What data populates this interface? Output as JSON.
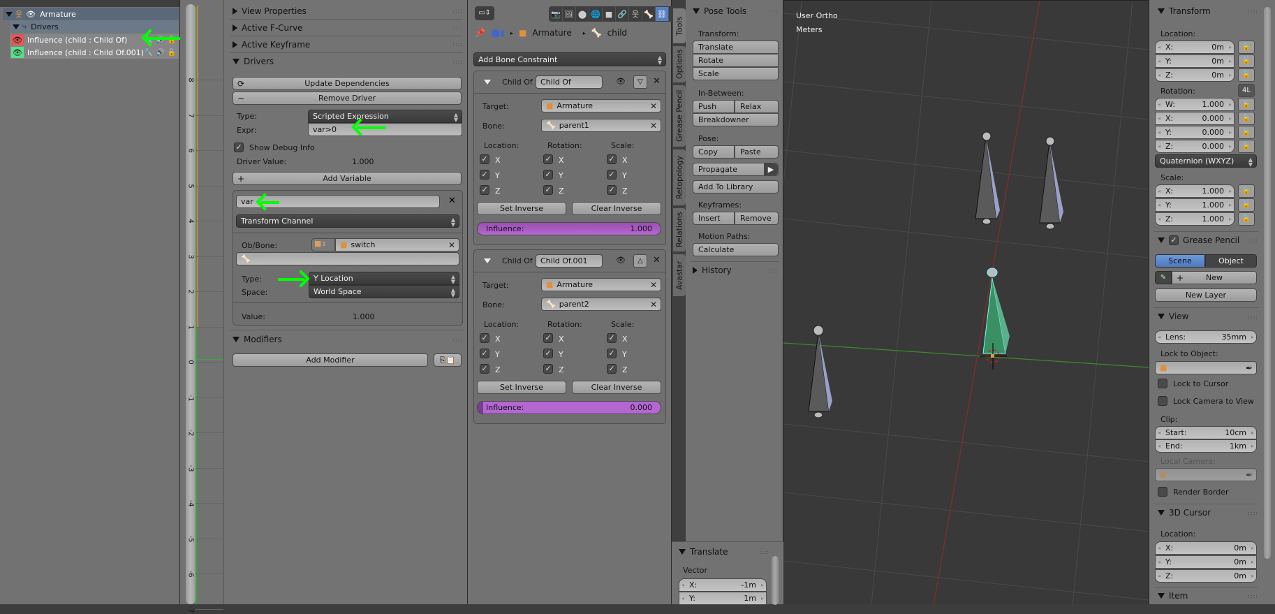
{
  "outliner": {
    "armature_label": "Armature",
    "drivers_label": "Drivers",
    "items": [
      {
        "label": "Influence (child : Child Of)",
        "color": "#e55656"
      },
      {
        "label": "Influence (child : Child Of.001)",
        "color": "#5ae08a"
      }
    ]
  },
  "graph": {
    "ticks": [
      "8",
      "7",
      "6",
      "5",
      "4",
      "3",
      "2",
      "1",
      "0",
      "-1",
      "-2",
      "-3",
      "-4",
      "-5",
      "-6",
      "-7"
    ]
  },
  "drivers_panel": {
    "sections": {
      "view_properties": "View Properties",
      "active_fcurve": "Active F-Curve",
      "active_keyframe": "Active Keyframe",
      "drivers": "Drivers",
      "modifiers": "Modifiers"
    },
    "update_dependencies": "Update Dependencies",
    "remove_driver": "Remove Driver",
    "type_label": "Type:",
    "type_value": "Scripted Expression",
    "expr_label": "Expr:",
    "expr_value": "var>0",
    "show_debug_label": "Show Debug Info",
    "show_debug_checked": true,
    "driver_value_label": "Driver Value:",
    "driver_value": "1.000",
    "add_variable": "Add Variable",
    "variable": {
      "name": "var",
      "var_type": "Transform Channel",
      "ob_bone_label": "Ob/Bone:",
      "object": "switch",
      "bone": "",
      "type_label": "Type:",
      "type_value": "Y Location",
      "space_label": "Space:",
      "space_value": "World Space",
      "value_label": "Value:",
      "value": "1.000"
    },
    "add_modifier": "Add Modifier"
  },
  "properties": {
    "breadcrumb": [
      "Armature",
      "child"
    ],
    "add_constraint": "Add Bone Constraint",
    "tab_icons": [
      "render",
      "render-layers",
      "scene",
      "world",
      "object",
      "constraints",
      "data",
      "bone",
      "bone-constraints",
      "texture",
      "particles"
    ],
    "constraints": [
      {
        "type": "Child Of",
        "name": "Child Of",
        "target_label": "Target:",
        "target": "Armature",
        "bone_label": "Bone:",
        "bone": "parent1",
        "location_label": "Location:",
        "rotation_label": "Rotation:",
        "scale_label": "Scale:",
        "axes": [
          "X",
          "Y",
          "Z"
        ],
        "set_inverse": "Set Inverse",
        "clear_inverse": "Clear Inverse",
        "influence_label": "Influence:",
        "influence": "1.000",
        "influence_fraction": 1.0,
        "move_dir": "down"
      },
      {
        "type": "Child Of",
        "name": "Child Of.001",
        "target_label": "Target:",
        "target": "Armature",
        "bone_label": "Bone:",
        "bone": "parent2",
        "location_label": "Location:",
        "rotation_label": "Rotation:",
        "scale_label": "Scale:",
        "axes": [
          "X",
          "Y",
          "Z"
        ],
        "set_inverse": "Set Inverse",
        "clear_inverse": "Clear Inverse",
        "influence_label": "Influence:",
        "influence": "0.000",
        "influence_fraction": 0.0,
        "move_dir": "up"
      }
    ]
  },
  "toolshelf": {
    "vtabs": [
      "Tools",
      "Options",
      "Grease Pencil",
      "Retopology",
      "Relations",
      "Avastar"
    ],
    "title": "Pose Tools",
    "transform_label": "Transform:",
    "translate": "Translate",
    "rotate": "Rotate",
    "scale": "Scale",
    "inbetween_label": "In-Between:",
    "push": "Push",
    "relax": "Relax",
    "breakdowner": "Breakdowner",
    "pose_label": "Pose:",
    "copy": "Copy",
    "paste": "Paste",
    "propagate": "Propagate",
    "add_to_library": "Add To Library",
    "keyframes_label": "Keyframes:",
    "insert": "Insert",
    "remove": "Remove",
    "motion_paths_label": "Motion Paths:",
    "calculate": "Calculate",
    "history": "History",
    "operator": {
      "title": "Translate",
      "vector_label": "Vector",
      "x_label": "X:",
      "x": "-1m",
      "y_label": "Y:",
      "y": "1m"
    }
  },
  "viewport": {
    "view_name": "User Ortho",
    "units": "Meters"
  },
  "npanel": {
    "transform_title": "Transform",
    "location_label": "Location:",
    "location": [
      {
        "k": "X:",
        "v": "0m"
      },
      {
        "k": "Y:",
        "v": "0m"
      },
      {
        "k": "Z:",
        "v": "0m"
      }
    ],
    "rotation_label": "Rotation:",
    "rotation_lock_label": "4L",
    "rotation": [
      {
        "k": "W:",
        "v": "1.000"
      },
      {
        "k": "X:",
        "v": "0.000"
      },
      {
        "k": "Y:",
        "v": "0.000"
      },
      {
        "k": "Z:",
        "v": "0.000"
      }
    ],
    "rotation_mode": "Quaternion (WXYZ)",
    "scale_label": "Scale:",
    "scale": [
      {
        "k": "X:",
        "v": "1.000"
      },
      {
        "k": "Y:",
        "v": "1.000"
      },
      {
        "k": "Z:",
        "v": "1.000"
      }
    ],
    "grease_pencil_title": "Grease Pencil",
    "gp_scene": "Scene",
    "gp_object": "Object",
    "gp_new": "New",
    "gp_new_layer": "New Layer",
    "view_title": "View",
    "lens_label": "Lens:",
    "lens": "35mm",
    "lock_to_object_label": "Lock to Object:",
    "lock_to_cursor": "Lock to Cursor",
    "lock_camera_to_view": "Lock Camera to View",
    "clip_label": "Clip:",
    "clip_start_label": "Start:",
    "clip_start": "10cm",
    "clip_end_label": "End:",
    "clip_end": "1km",
    "local_camera_label": "Local Camera:",
    "render_border": "Render Border",
    "cursor_title": "3D Cursor",
    "cursor_location_label": "Location:",
    "cursor": [
      {
        "k": "X:",
        "v": "0m"
      },
      {
        "k": "Y:",
        "v": "0m"
      },
      {
        "k": "Z:",
        "v": "0m"
      }
    ],
    "item_title": "Item"
  }
}
